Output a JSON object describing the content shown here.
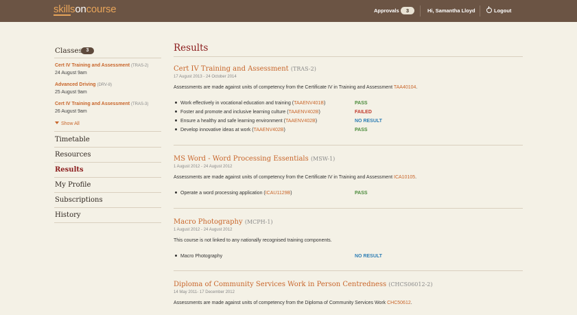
{
  "header": {
    "logo": {
      "part1": "skills",
      "part2": "on",
      "part3": "course"
    },
    "approvals_label": "Approvals",
    "approvals_count": "3",
    "greeting": "Hi, Samantha Lloyd",
    "logout_label": "Logout"
  },
  "sidebar": {
    "classes_label": "Classes",
    "classes_count": "3",
    "classes": [
      {
        "title": "Cert IV Training and Assessment",
        "code": "(TRAS-2)",
        "date": "24 August 9am"
      },
      {
        "title": "Advanced Driving",
        "code": "(DRV-8)",
        "date": "25 August 9am"
      },
      {
        "title": "Cert IV Training and Assessment",
        "code": "(TRAS-3)",
        "date": "26 August 9am"
      }
    ],
    "show_all": "Show All",
    "nav": [
      "Timetable",
      "Resources",
      "Results",
      "My Profile",
      "Subscriptions",
      "History"
    ],
    "active_nav": "Results"
  },
  "main": {
    "title": "Results",
    "courses": [
      {
        "title": "Cert IV Training and Assessment",
        "code": "(TRAS-2)",
        "dates": "17 August 2013 - 24 October 2014",
        "desc_pre": "Assessments are made against units of competency from the Certificate IV in Training and Assessment ",
        "desc_link": "TAA40104",
        "desc_post": ".",
        "units": [
          {
            "name": "Work effectively in vocational education and training (",
            "unit": "TAAENV401B",
            "post": ")",
            "status": "PASS"
          },
          {
            "name": "Foster and promote and inclusive learning culture (",
            "unit": "TAAENV402B",
            "post": ")",
            "status": "FAILED"
          },
          {
            "name": "Ensure a healthy and safe learning environment (",
            "unit": "TAAENV402B",
            "post": ")",
            "status": "NO RESULT"
          },
          {
            "name": "Develop innovative ideas at work (",
            "unit": "TAAENV402B",
            "post": ")",
            "status": "PASS"
          }
        ]
      },
      {
        "title": "MS Word - Word Processing Essentials",
        "code": "(MSW-1)",
        "dates": "1 August 2012 - 24 August 2012",
        "desc_pre": "Assessments are made against units of competency from the Certificate IV in Training and Assessment ",
        "desc_link": "ICA10105",
        "desc_post": ".",
        "units": [
          {
            "name": "Operate a word processing application (",
            "unit": "ICAU1129B",
            "post": ")",
            "status": "PASS"
          }
        ]
      },
      {
        "title": "Macro Photography",
        "code": "(MCPH-1)",
        "dates": "1 August 2012 - 24 August 2012",
        "desc_pre": "This course is not linked to any nationally recognised training components.",
        "units": [
          {
            "name": "Macro Photography",
            "status": "NO RESULT"
          }
        ]
      },
      {
        "title": "Diploma of Community Services Work in Person Centredness",
        "code": "(CHCS06012-2)",
        "dates": "14 May 2011- 17 December 2012",
        "desc_pre": "Assessments are made against units of competency from the Diploma of Community Services Work ",
        "desc_link": "CHC50612",
        "desc_post": "."
      }
    ]
  },
  "colors": {
    "header_bg": "#6b5444",
    "page_bg": "#f4f1e6",
    "accent": "#c8652a",
    "active": "#8b1c1c",
    "pass": "#4a8a3a",
    "failed": "#c0392b",
    "no_result": "#2f7fb5"
  }
}
